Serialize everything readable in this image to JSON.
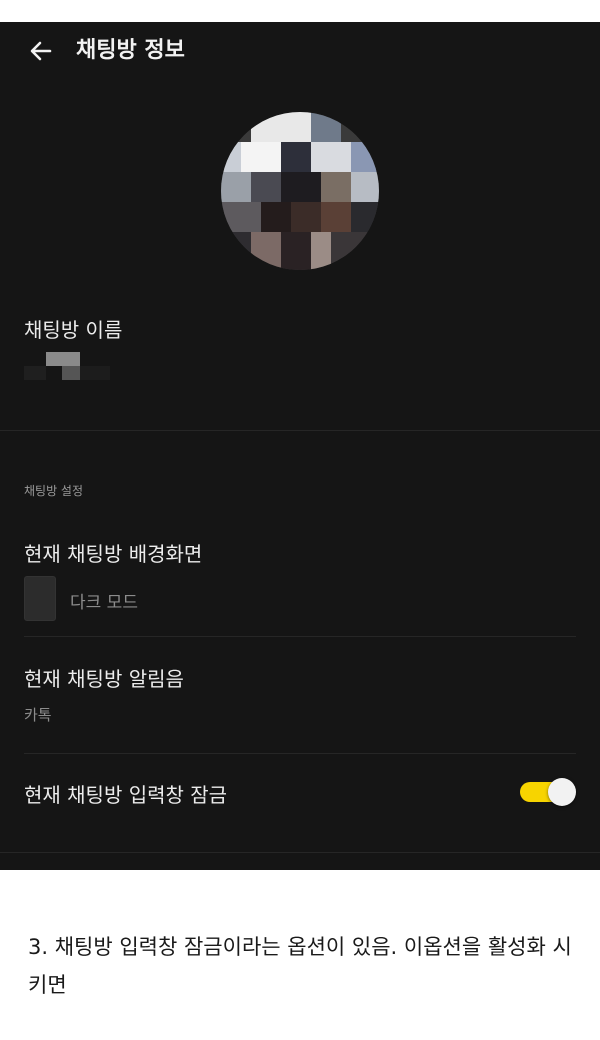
{
  "header": {
    "title": "채팅방 정보",
    "back_icon": "arrow-left-icon"
  },
  "profile": {
    "avatar": "blurred-profile-image"
  },
  "room_name": {
    "label": "채팅방 이름",
    "value_state": "blurred"
  },
  "settings": {
    "section_title": "채팅방 설정",
    "background": {
      "title": "현재 채팅방 배경화면",
      "value": "다크 모드"
    },
    "notification": {
      "title": "현재 채팅방 알림음",
      "value": "카톡"
    },
    "input_lock": {
      "title": "현재 채팅방 입력창 잠금",
      "enabled": true
    }
  },
  "caption": {
    "text": "3. 채팅방 입력창 잠금이라는 옵션이 있음. 이옵션을 활성화 시키면"
  },
  "colors": {
    "background": "#151515",
    "toggle_on": "#f7d400",
    "text_primary": "#ececec",
    "text_secondary": "#8c8c8c"
  }
}
